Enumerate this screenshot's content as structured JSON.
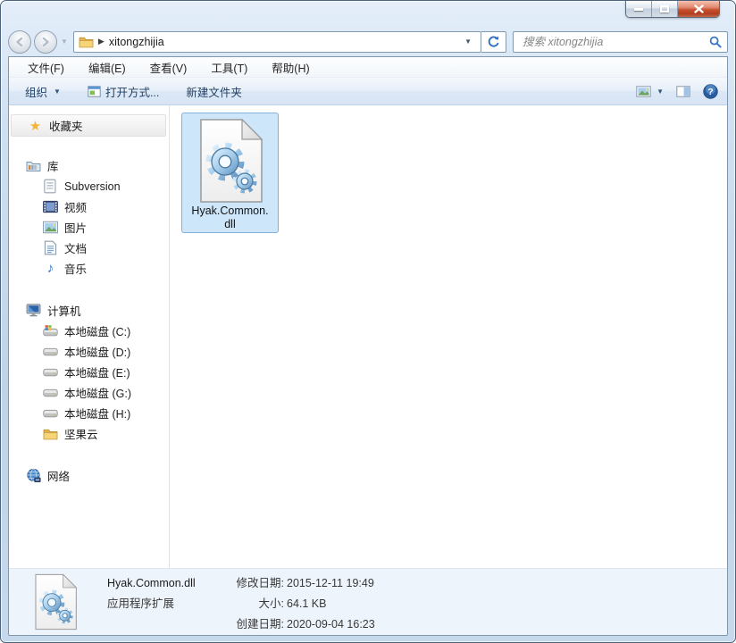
{
  "window": {
    "buttons": {
      "minimize": "minimize",
      "maximize": "maximize",
      "close": "close"
    }
  },
  "nav": {
    "path": "xitongzhijia",
    "search_placeholder": "搜索 xitongzhijia"
  },
  "menu": {
    "items": [
      {
        "label": "文件(F)"
      },
      {
        "label": "编辑(E)"
      },
      {
        "label": "查看(V)"
      },
      {
        "label": "工具(T)"
      },
      {
        "label": "帮助(H)"
      }
    ]
  },
  "toolbar": {
    "organize_label": "组织",
    "open_with_label": "打开方式...",
    "new_folder_label": "新建文件夹"
  },
  "sidebar": {
    "favorites_label": "收藏夹",
    "libraries_label": "库",
    "libraries": [
      {
        "label": "Subversion"
      },
      {
        "label": "视频"
      },
      {
        "label": "图片"
      },
      {
        "label": "文档"
      },
      {
        "label": "音乐"
      }
    ],
    "computer_label": "计算机",
    "computer": [
      {
        "label": "本地磁盘 (C:)"
      },
      {
        "label": "本地磁盘 (D:)"
      },
      {
        "label": "本地磁盘 (E:)"
      },
      {
        "label": "本地磁盘 (G:)"
      },
      {
        "label": "本地磁盘 (H:)"
      },
      {
        "label": "坚果云"
      }
    ],
    "network_label": "网络"
  },
  "files": [
    {
      "label_line1": "Hyak.Common.",
      "label_line2": "dll",
      "selected": true
    }
  ],
  "details": {
    "file_name": "Hyak.Common.dll",
    "file_type": "应用程序扩展",
    "modified_label": "修改日期:",
    "modified_value": "2015-12-11 19:49",
    "size_label": "大小:",
    "size_value": "64.1 KB",
    "created_label": "创建日期:",
    "created_value": "2020-09-04 16:23"
  },
  "icons": {
    "search": "magnifier",
    "refresh": "circular-arrows",
    "help": "question-mark",
    "favorites": "gold-star",
    "file_type_icon": "dll-gears-page"
  },
  "colors": {
    "selection_bg": "#cde6fa",
    "selection_border": "#84b0d9",
    "frame_glass": "#c6d9ec",
    "details_bg": "#eef4fb",
    "toolbar_text": "#1e3c5f",
    "close_button": "#c8502f"
  }
}
